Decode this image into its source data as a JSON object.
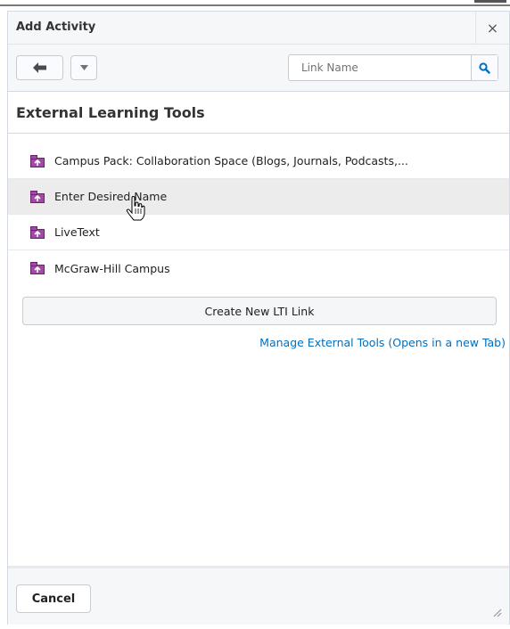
{
  "dialog": {
    "title": "Add Activity",
    "close_label": "×"
  },
  "toolbar": {
    "search_placeholder": "Link Name"
  },
  "section": {
    "heading": "External Learning Tools"
  },
  "tools": [
    {
      "label": "Campus Pack: Collaboration Space (Blogs, Journals, Podcasts,..."
    },
    {
      "label": "Enter Desired Name"
    },
    {
      "label": "LiveText"
    },
    {
      "label": "McGraw-Hill Campus"
    }
  ],
  "actions": {
    "create_label": "Create New LTI Link",
    "manage_label": "Manage External Tools (Opens in a new Tab)",
    "cancel_label": "Cancel"
  },
  "colors": {
    "accent": "#006fbf",
    "tool_icon": "#8b2f8e",
    "hover_row": "#ececec"
  },
  "icons": {
    "back": "arrow-left-icon",
    "more": "chevron-down-icon",
    "search": "search-icon",
    "tool": "lti-tool-icon",
    "close": "close-icon"
  }
}
